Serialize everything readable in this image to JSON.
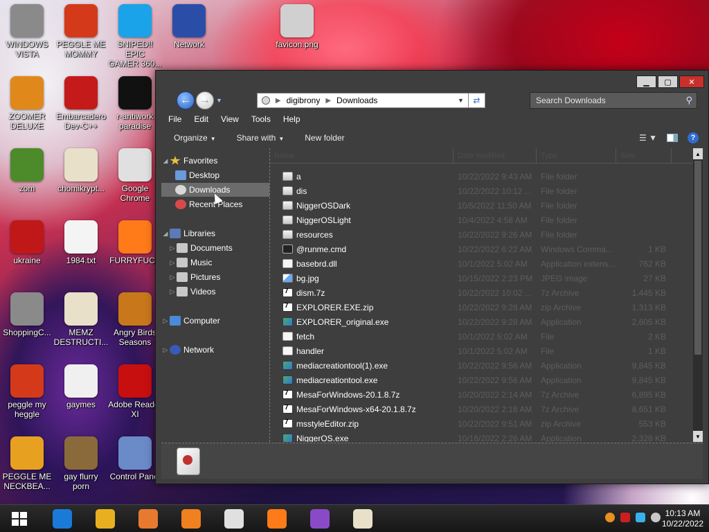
{
  "desktop": {
    "icons": [
      {
        "label": "WINDOWS\nVISTA",
        "icon": "robot-icon",
        "color": "#8a8a8a"
      },
      {
        "label": "PEGGLE ME\nMOMMY",
        "icon": "peggle-icon",
        "color": "#d43a1a"
      },
      {
        "label": "SNIPED!! EPIC\nGAMER 360...",
        "icon": "skype-icon",
        "color": "#1aa3e8"
      },
      {
        "label": "Network",
        "icon": "network-globe-icon",
        "color": "#2a4ea8"
      },
      {
        "label": "favicon.png",
        "icon": "computer-image-icon",
        "color": "#d0d0d0"
      },
      {
        "label": "ZOOMER\nDELUXE",
        "icon": "zoomer-icon",
        "color": "#e0891a"
      },
      {
        "label": "Embarcadero\nDev-C++",
        "icon": "devcpp-icon",
        "color": "#c41a1a"
      },
      {
        "label": "r-antiwork\nparadise",
        "icon": "antiwork-icon",
        "color": "#111111"
      },
      {
        "label": "zom",
        "icon": "flower-icon",
        "color": "#4c8a2a"
      },
      {
        "label": "chomikrypt...",
        "icon": "file-clock-icon",
        "color": "#e8e0c8"
      },
      {
        "label": "Google\nChrome",
        "icon": "chrome-icon",
        "color": "#e0e0e0"
      },
      {
        "label": "ukraine",
        "icon": "radiation-icon",
        "color": "#c01818"
      },
      {
        "label": "1984.txt",
        "icon": "text-file-icon",
        "color": "#f4f4f4"
      },
      {
        "label": "FURRYFUCK",
        "icon": "firefox-icon",
        "color": "#ff7a18"
      },
      {
        "label": "ShoppingC...",
        "icon": "flash-icon",
        "color": "#8a8a8a"
      },
      {
        "label": "MEMZ\nDESTRUCTI...",
        "icon": "file-clock-icon",
        "color": "#e8e0c8"
      },
      {
        "label": "Angry Birds\nSeasons",
        "icon": "angry-birds-icon",
        "color": "#c8781a"
      },
      {
        "label": "peggle my\nheggle",
        "icon": "peggle-icon",
        "color": "#d43a1a"
      },
      {
        "label": "gaymes",
        "icon": "document-icon",
        "color": "#f0f0f0"
      },
      {
        "label": "Adobe Reader\nXI",
        "icon": "adobe-reader-icon",
        "color": "#c80f0f"
      },
      {
        "label": "PEGGLE ME\nNECKBEA...",
        "icon": "peggle-icon",
        "color": "#e8a020"
      },
      {
        "label": "gay flurry\nporn",
        "icon": "box-icon",
        "color": "#8a6a3a"
      },
      {
        "label": "Control Panel",
        "icon": "control-panel-icon",
        "color": "#6a8ac8"
      }
    ]
  },
  "window": {
    "caption": {
      "minimize": "▁",
      "maximize": "▢",
      "close": "✕"
    },
    "breadcrumb": [
      "digibrony",
      "Downloads"
    ],
    "search_placeholder": "Search Downloads",
    "menu": [
      "File",
      "Edit",
      "View",
      "Tools",
      "Help"
    ],
    "toolbar": {
      "organize": "Organize",
      "share": "Share with",
      "new_folder": "New folder"
    },
    "columns": {
      "name": "Name",
      "date": "Date modified",
      "type": "Type",
      "size": "Size"
    },
    "nav": {
      "favorites": "Favorites",
      "desktop": "Desktop",
      "downloads": "Downloads",
      "recent": "Recent Places",
      "libraries": "Libraries",
      "documents": "Documents",
      "music": "Music",
      "pictures": "Pictures",
      "videos": "Videos",
      "computer": "Computer",
      "network": "Network"
    },
    "files": [
      {
        "name": "a",
        "date": "10/22/2022 9:43 AM",
        "type": "File folder",
        "size": "",
        "kind": "folder"
      },
      {
        "name": "dis",
        "date": "10/22/2022 10:12 ...",
        "type": "File folder",
        "size": "",
        "kind": "folder"
      },
      {
        "name": "NiggerOSDark",
        "date": "10/5/2022 11:50 AM",
        "type": "File folder",
        "size": "",
        "kind": "folder"
      },
      {
        "name": "NiggerOSLight",
        "date": "10/4/2022 4:58 AM",
        "type": "File folder",
        "size": "",
        "kind": "folder"
      },
      {
        "name": "resources",
        "date": "10/22/2022 9:26 AM",
        "type": "File folder",
        "size": "",
        "kind": "folder"
      },
      {
        "name": "@runme.cmd",
        "date": "10/22/2022 6:22 AM",
        "type": "Windows Comma...",
        "size": "1 KB",
        "kind": "cmd"
      },
      {
        "name": "basebrd.dll",
        "date": "10/1/2022 5:02 AM",
        "type": "Application extens...",
        "size": "762 KB",
        "kind": "file"
      },
      {
        "name": "bg.jpg",
        "date": "10/15/2022 2:23 PM",
        "type": "JPEG image",
        "size": "27 KB",
        "kind": "img"
      },
      {
        "name": "dism.7z",
        "date": "10/22/2022 10:02 ...",
        "type": "7z Archive",
        "size": "1,445 KB",
        "kind": "zip"
      },
      {
        "name": "EXPLORER.EXE.zip",
        "date": "10/22/2022 9:28 AM",
        "type": "zip Archive",
        "size": "1,313 KB",
        "kind": "zip"
      },
      {
        "name": "EXPLORER_original.exe",
        "date": "10/22/2022 9:28 AM",
        "type": "Application",
        "size": "2,605 KB",
        "kind": "exe"
      },
      {
        "name": "fetch",
        "date": "10/1/2022 5:02 AM",
        "type": "File",
        "size": "2 KB",
        "kind": "file"
      },
      {
        "name": "handler",
        "date": "10/1/2022 5:02 AM",
        "type": "File",
        "size": "1 KB",
        "kind": "file"
      },
      {
        "name": "mediacreationtool(1).exe",
        "date": "10/22/2022 9:56 AM",
        "type": "Application",
        "size": "9,845 KB",
        "kind": "exe"
      },
      {
        "name": "mediacreationtool.exe",
        "date": "10/22/2022 9:56 AM",
        "type": "Application",
        "size": "9,845 KB",
        "kind": "exe"
      },
      {
        "name": "MesaForWindows-20.1.8.7z",
        "date": "10/20/2022 2:14 AM",
        "type": "7z Archive",
        "size": "6,895 KB",
        "kind": "zip"
      },
      {
        "name": "MesaForWindows-x64-20.1.8.7z",
        "date": "10/20/2022 2:16 AM",
        "type": "7z Archive",
        "size": "8,651 KB",
        "kind": "zip"
      },
      {
        "name": "msstyleEditor.zip",
        "date": "10/22/2022 9:51 AM",
        "type": "zip Archive",
        "size": "553 KB",
        "kind": "zip"
      },
      {
        "name": "NiggerOS.exe",
        "date": "10/16/2022 2:26 AM",
        "type": "Application",
        "size": "2,328 KB",
        "kind": "exe"
      }
    ]
  },
  "taskbar": {
    "apps": [
      "start-icon",
      "internet-explorer-icon",
      "file-explorer-icon",
      "media-player-icon",
      "uc-browser-icon",
      "chrome-icon",
      "firefox-icon",
      "visual-studio-icon",
      "file-clock-icon"
    ],
    "time": "10:13 AM",
    "date": "10/22/2022"
  }
}
